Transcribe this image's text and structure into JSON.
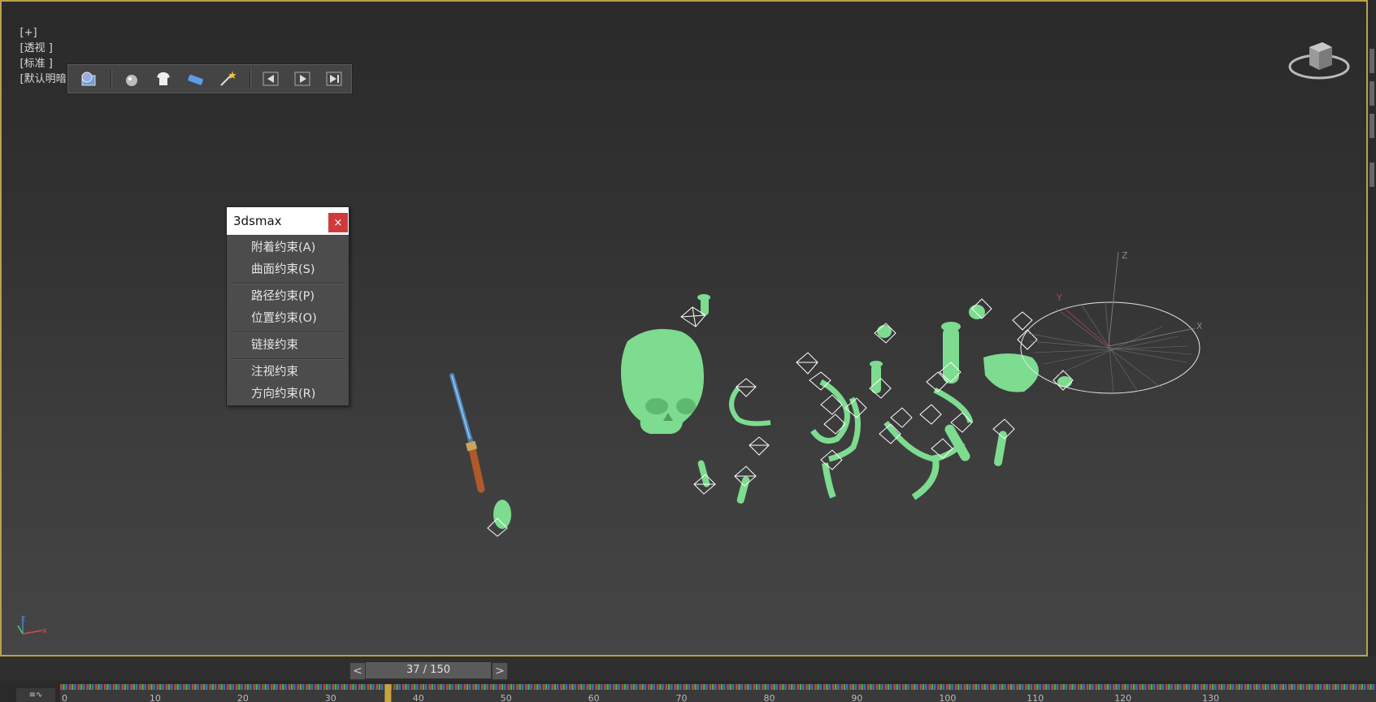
{
  "viewport": {
    "label_plus": "[+]",
    "label_view": "[透视 ]",
    "label_shading": "[标准 ]",
    "label_lighting": "[默认明暗处理 ]"
  },
  "toolbar": {
    "icons": [
      "render-setup-icon",
      "sphere-icon",
      "shirt-icon",
      "eraser-icon",
      "magic-wand-icon",
      "prev-key-icon",
      "play-icon",
      "next-key-icon"
    ]
  },
  "popup": {
    "title": "3dsmax",
    "close": "×",
    "groups": [
      [
        "附着约束(A)",
        "曲面约束(S)"
      ],
      [
        "路径约束(P)",
        "位置约束(O)"
      ],
      [
        "链接约束"
      ],
      [
        "注视约束",
        "方向约束(R)"
      ]
    ]
  },
  "gizmo": {
    "z": "Z",
    "x": "X",
    "y": "Y"
  },
  "axis_tripod": {
    "z": "z",
    "x": "x"
  },
  "timeslider": {
    "prev": "<",
    "next": ">",
    "frame": "37 / 150",
    "current": 37,
    "total": 150
  },
  "ruler": {
    "labels": [
      "0",
      "10",
      "20",
      "30",
      "40",
      "50",
      "60",
      "70",
      "80",
      "90",
      "100",
      "110",
      "120",
      "130"
    ]
  },
  "colors": {
    "object": "#7ddc8f",
    "viewport_border": "#b8a24a",
    "close_button": "#cf3b3b",
    "time_marker": "#c8a43c"
  }
}
